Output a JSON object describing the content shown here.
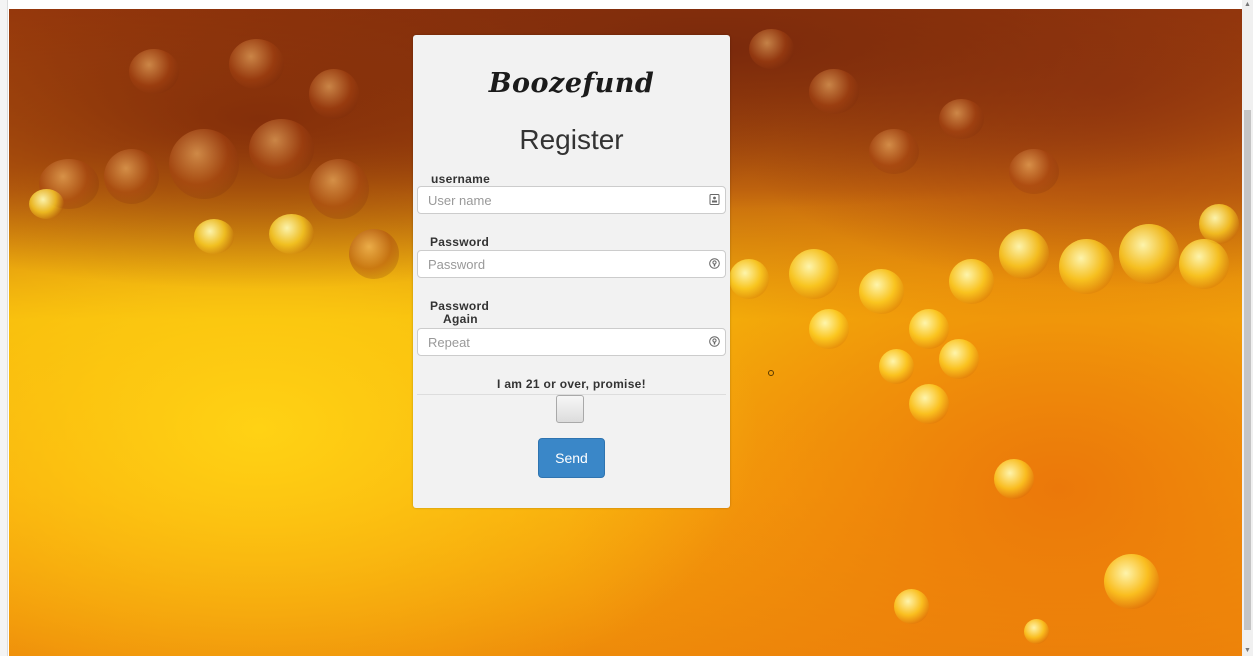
{
  "brand": "Boozefund",
  "heading": "Register",
  "form": {
    "username": {
      "label": "username",
      "placeholder": "User name",
      "value": "",
      "icon": "id-card-icon"
    },
    "password": {
      "label": "Password",
      "placeholder": "Password",
      "value": "",
      "icon": "lock-icon"
    },
    "password_again": {
      "label_line1": "Password",
      "label_line2": "Again",
      "placeholder": "Repeat",
      "value": "",
      "icon": "lock-icon"
    },
    "age_check": {
      "label": "I am 21 or over, promise!",
      "checked": false
    },
    "submit_label": "Send"
  },
  "colors": {
    "button": "#3a87c8",
    "card": "#f2f2f2"
  }
}
